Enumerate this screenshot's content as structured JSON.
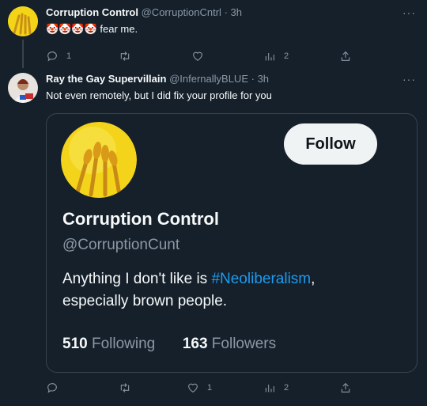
{
  "tweet1": {
    "name": "Corruption Control",
    "handle": "@CorruptionCntrl",
    "separator": "·",
    "time": "3h",
    "emoji": "🤡🤡🤡🤡",
    "text": "fear me.",
    "more": "···",
    "actions": {
      "reply_icon": "reply-icon",
      "reply_count": "1",
      "retweet_icon": "retweet-icon",
      "retweet_count": "",
      "like_icon": "heart-icon",
      "like_count": "",
      "views_icon": "views-icon",
      "views_count": "2",
      "share_icon": "share-icon"
    }
  },
  "tweet2": {
    "name": "Ray the Gay Supervillain",
    "handle": "@InfernallyBLUE",
    "separator": "·",
    "time": "3h",
    "text": "Not even remotely, but I did fix your profile for you",
    "more": "···",
    "actions": {
      "reply_icon": "reply-icon",
      "reply_count": "",
      "retweet_icon": "retweet-icon",
      "retweet_count": "",
      "like_icon": "heart-icon",
      "like_count": "1",
      "views_icon": "views-icon",
      "views_count": "2",
      "share_icon": "share-icon"
    }
  },
  "card": {
    "follow_label": "Follow",
    "name": "Corruption Control",
    "handle": "@CorruptionCunt",
    "bio_pre": "Anything I don't like is ",
    "bio_hashtag": "#Neoliberalism",
    "bio_post": ",",
    "bio_line2": "especially brown people.",
    "following_count": "510",
    "following_label": "Following",
    "followers_count": "163",
    "followers_label": "Followers"
  },
  "colors": {
    "background": "#15202b",
    "text": "#f7f9f9",
    "muted": "#8b98a5",
    "accent": "#1d9bf0",
    "border": "#38444d",
    "avatar_yellow": "#f2d21b"
  }
}
